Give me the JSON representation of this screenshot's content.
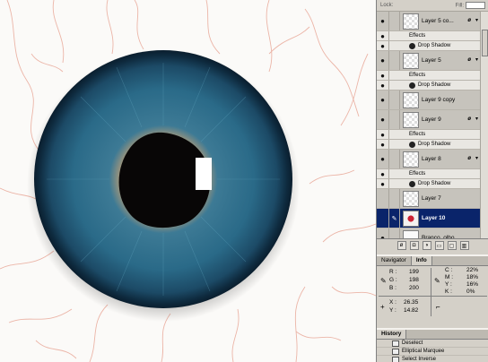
{
  "lock_bar": {
    "lock_label": "Lock:",
    "fill_label": "Fill:"
  },
  "layers": [
    {
      "kind": "layer",
      "name": "Layer 5 co...",
      "fx": "ø",
      "visible": true
    },
    {
      "kind": "effect-header",
      "name": "Effects"
    },
    {
      "kind": "effect",
      "name": "Drop Shadow"
    },
    {
      "kind": "layer",
      "name": "Layer 5",
      "fx": "ø",
      "visible": true
    },
    {
      "kind": "effect-header",
      "name": "Effects"
    },
    {
      "kind": "effect",
      "name": "Drop Shadow"
    },
    {
      "kind": "layer",
      "name": "Layer 9 copy",
      "fx": "",
      "visible": true
    },
    {
      "kind": "layer",
      "name": "Layer 9",
      "fx": "ø",
      "visible": true
    },
    {
      "kind": "effect-header",
      "name": "Effects"
    },
    {
      "kind": "effect",
      "name": "Drop Shadow"
    },
    {
      "kind": "layer",
      "name": "Layer 8",
      "fx": "ø",
      "visible": true
    },
    {
      "kind": "effect-header",
      "name": "Effects"
    },
    {
      "kind": "effect",
      "name": "Drop Shadow"
    },
    {
      "kind": "layer",
      "name": "Layer 7",
      "fx": "",
      "visible": false
    },
    {
      "kind": "layer",
      "name": "Layer 10",
      "fx": "",
      "visible": false,
      "selected": true
    },
    {
      "kind": "layer",
      "name": "Branco_olho",
      "fx": "",
      "visible": true
    }
  ],
  "info_panel": {
    "tabs": [
      "Navigator",
      "Info"
    ],
    "active_tab": "Info",
    "rgb": {
      "r_label": "R :",
      "r": "199",
      "g_label": "G :",
      "g": "198",
      "b_label": "B :",
      "b": "200"
    },
    "cmyk": {
      "c_label": "C :",
      "c": "22%",
      "m_label": "M :",
      "m": "18%",
      "y_label": "Y :",
      "y": "16%",
      "k_label": "K :",
      "k": "0%"
    },
    "xy": {
      "x_label": "X :",
      "x": "26.35",
      "y_label": "Y :",
      "y": "14.82"
    }
  },
  "history_panel": {
    "tab": "History",
    "items": [
      "Deselect",
      "Elliptical Marquee",
      "Select Inverse"
    ]
  }
}
